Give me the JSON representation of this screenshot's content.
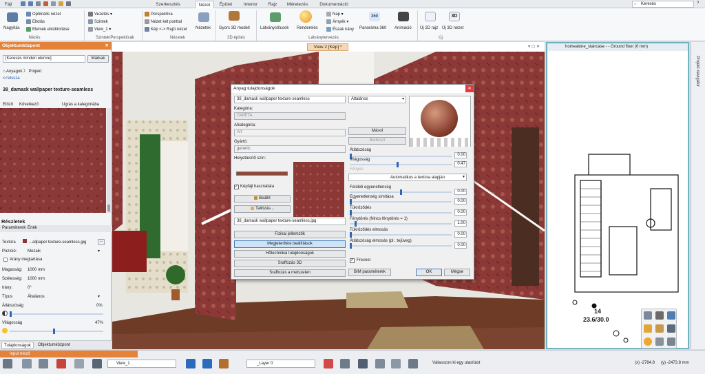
{
  "ribbon": {
    "tabs": [
      "Fájl",
      "Szerkesztés",
      "Nézet",
      "Épület",
      "Interior",
      "Rajz",
      "Méretezés",
      "Dokumentáció"
    ],
    "active_tab": "Nézet",
    "search_placeholder": "Keresés",
    "groups": {
      "nezes": {
        "label": "Nézés",
        "big": "Nagyítás",
        "items": [
          "Optimális nézet",
          "Eltolás",
          "Elemek elkülönítése"
        ]
      },
      "szintek": {
        "label": "Szintek/Perspektívák",
        "items": [
          "Vezetés",
          "Szintek",
          "View_1"
        ]
      },
      "nezetek": {
        "label": "Nézetek",
        "items": [
          "Perspektíva",
          "Nézet két ponttal",
          "Kép <-> Rajzi nézet"
        ],
        "big": "Nézetek"
      },
      "epites3d": {
        "label": "3D építés",
        "big": "Gyors 3D modell"
      },
      "latvany": {
        "label": "Látványtervezés",
        "big1": "Látványstílusok",
        "big2": "Renderelés",
        "items": [
          "Nap",
          "Árnyék",
          "Észak irány"
        ],
        "big3": "Panoráma 360",
        "big3_sub": "360",
        "big4": "Animáció"
      },
      "uj": {
        "label": "Új",
        "b1": "Új 2D rajz",
        "b2": "Új 3D nézet",
        "b2_sub": "3D"
      }
    }
  },
  "left_panel": {
    "title": "Objektumközpont",
    "search_value": "[Keresés minden elemre]",
    "search_button": "Márkak",
    "nav": [
      "Anyagok",
      "Projekt"
    ],
    "back": "<<Vissza",
    "material_name": "38_damask wallpaper texture-seamless",
    "links": [
      "Előző",
      "Következő",
      "Ugrás a kategóriába"
    ],
    "details_title": "Részletek",
    "details_tabs": [
      "Paraméterek",
      "Érték"
    ],
    "props": [
      {
        "k": "Textúra",
        "v": "...allpaper texture-seamless.jpg"
      },
      {
        "k": "Pozíció:",
        "v": "Mozaik"
      },
      {
        "k": "Arány megtartása",
        "v": ""
      },
      {
        "k": "Magasság:",
        "v": "1000 mm"
      },
      {
        "k": "Szélesség:",
        "v": "1000 mm"
      },
      {
        "k": "Irány:",
        "v": "0°"
      },
      {
        "k": "Típus",
        "v": "Általános"
      }
    ],
    "atlatszosag": {
      "label": "Átlátszóság",
      "value": "0%"
    },
    "vilagossag": {
      "label": "Világosság",
      "value": "47%"
    },
    "bottom_tabs": [
      "Tulajdonságok",
      "Objektumközpont"
    ]
  },
  "viewport": {
    "title": "View 2 [Kép] *"
  },
  "right_view": {
    "title": "homealone_staircase - - Ground floor (0 mm)",
    "nav_label": "Projekt navigátor",
    "stair_num": "14",
    "stair_dim": "23.6/30.0"
  },
  "dialog": {
    "title": "Anyag tulajdonságok",
    "name": "38_damask wallpaper texture-seamless",
    "kategoria_label": "Kategória:",
    "kategoria_value": "TAPÉTA",
    "alkategoria_label": "Alkategória:",
    "alkategoria_value": "Art",
    "gyarto_label": "Gyártó:",
    "gyarto_value": "generic",
    "helyettesito_label": "Helyettesítő szín:",
    "kepfajl_label": "Képfájl használata",
    "beallit": "Beállít",
    "tallozas": "Tallózás...",
    "file": "38_damask wallpaper texture-seamless.jpg",
    "buttons": [
      "Fizikai jellemzők",
      "Megjelenítési beállítások",
      "Hőtechnikai tulajdonságok",
      "Sraffozás 3D",
      "Sraffozás a metszeten"
    ],
    "dropdown": "Általános",
    "masol": "Másol",
    "beilleszt": "Beilleszt",
    "atlatszosag": {
      "label": "Átlátszóság",
      "value": "0.00"
    },
    "vilagossag": {
      "label": "Világosság",
      "value": "0.47"
    },
    "fenyes_label": "Fényes",
    "auto": "Automatikus a textúra alapján",
    "sliders": [
      {
        "label": "Felületi egyenetlenség",
        "value": "0.00",
        "pos": 0.5
      },
      {
        "label": "Egyenetlenség simítása",
        "value": "0.00",
        "pos": 0.0
      },
      {
        "label": "Tükröződés",
        "value": "0.00",
        "pos": 0.0
      },
      {
        "label": "Fénytörés (Nincs fénytörés = 1)",
        "value": "1.00",
        "pos": 0.05
      },
      {
        "label": "Tükröződés elmosás",
        "value": "0.00",
        "pos": 0.0
      },
      {
        "label": "Átlátszóság elmosás (pl.: tejüveg)",
        "value": "0.00",
        "pos": 0.0
      }
    ],
    "fresnel": "Fresnel",
    "bim": "BIM paraméterek",
    "ok": "OK",
    "megse": "Mégse"
  },
  "statusbar": {
    "input_label": "Input mező",
    "view": "View_1",
    "layer": "_Layer 0",
    "hint": "Válasszon ki egy utasítást",
    "x": "(x) -2784.8",
    "y": "(y) -2473.8 mm"
  },
  "colors": {
    "accent": "#e4823a",
    "wallpaper": "#8d3c3b",
    "blue_btn": "#cfe3f7"
  }
}
